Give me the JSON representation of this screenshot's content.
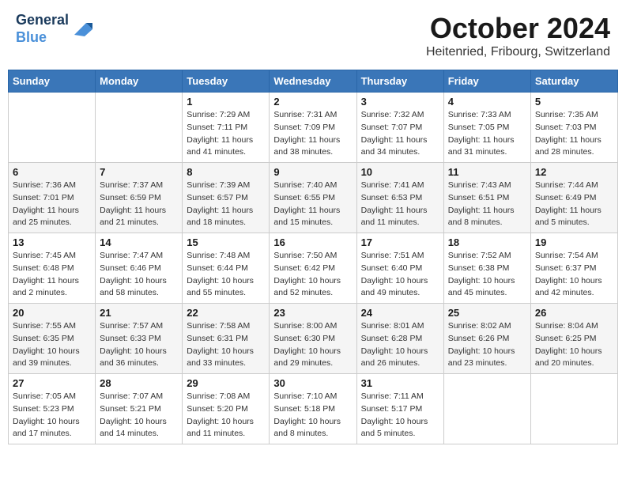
{
  "header": {
    "logo_line1": "General",
    "logo_line2": "Blue",
    "title": "October 2024",
    "subtitle": "Heitenried, Fribourg, Switzerland"
  },
  "calendar": {
    "days_of_week": [
      "Sunday",
      "Monday",
      "Tuesday",
      "Wednesday",
      "Thursday",
      "Friday",
      "Saturday"
    ],
    "weeks": [
      [
        {
          "day": "",
          "info": ""
        },
        {
          "day": "",
          "info": ""
        },
        {
          "day": "1",
          "info": "Sunrise: 7:29 AM\nSunset: 7:11 PM\nDaylight: 11 hours and 41 minutes."
        },
        {
          "day": "2",
          "info": "Sunrise: 7:31 AM\nSunset: 7:09 PM\nDaylight: 11 hours and 38 minutes."
        },
        {
          "day": "3",
          "info": "Sunrise: 7:32 AM\nSunset: 7:07 PM\nDaylight: 11 hours and 34 minutes."
        },
        {
          "day": "4",
          "info": "Sunrise: 7:33 AM\nSunset: 7:05 PM\nDaylight: 11 hours and 31 minutes."
        },
        {
          "day": "5",
          "info": "Sunrise: 7:35 AM\nSunset: 7:03 PM\nDaylight: 11 hours and 28 minutes."
        }
      ],
      [
        {
          "day": "6",
          "info": "Sunrise: 7:36 AM\nSunset: 7:01 PM\nDaylight: 11 hours and 25 minutes."
        },
        {
          "day": "7",
          "info": "Sunrise: 7:37 AM\nSunset: 6:59 PM\nDaylight: 11 hours and 21 minutes."
        },
        {
          "day": "8",
          "info": "Sunrise: 7:39 AM\nSunset: 6:57 PM\nDaylight: 11 hours and 18 minutes."
        },
        {
          "day": "9",
          "info": "Sunrise: 7:40 AM\nSunset: 6:55 PM\nDaylight: 11 hours and 15 minutes."
        },
        {
          "day": "10",
          "info": "Sunrise: 7:41 AM\nSunset: 6:53 PM\nDaylight: 11 hours and 11 minutes."
        },
        {
          "day": "11",
          "info": "Sunrise: 7:43 AM\nSunset: 6:51 PM\nDaylight: 11 hours and 8 minutes."
        },
        {
          "day": "12",
          "info": "Sunrise: 7:44 AM\nSunset: 6:49 PM\nDaylight: 11 hours and 5 minutes."
        }
      ],
      [
        {
          "day": "13",
          "info": "Sunrise: 7:45 AM\nSunset: 6:48 PM\nDaylight: 11 hours and 2 minutes."
        },
        {
          "day": "14",
          "info": "Sunrise: 7:47 AM\nSunset: 6:46 PM\nDaylight: 10 hours and 58 minutes."
        },
        {
          "day": "15",
          "info": "Sunrise: 7:48 AM\nSunset: 6:44 PM\nDaylight: 10 hours and 55 minutes."
        },
        {
          "day": "16",
          "info": "Sunrise: 7:50 AM\nSunset: 6:42 PM\nDaylight: 10 hours and 52 minutes."
        },
        {
          "day": "17",
          "info": "Sunrise: 7:51 AM\nSunset: 6:40 PM\nDaylight: 10 hours and 49 minutes."
        },
        {
          "day": "18",
          "info": "Sunrise: 7:52 AM\nSunset: 6:38 PM\nDaylight: 10 hours and 45 minutes."
        },
        {
          "day": "19",
          "info": "Sunrise: 7:54 AM\nSunset: 6:37 PM\nDaylight: 10 hours and 42 minutes."
        }
      ],
      [
        {
          "day": "20",
          "info": "Sunrise: 7:55 AM\nSunset: 6:35 PM\nDaylight: 10 hours and 39 minutes."
        },
        {
          "day": "21",
          "info": "Sunrise: 7:57 AM\nSunset: 6:33 PM\nDaylight: 10 hours and 36 minutes."
        },
        {
          "day": "22",
          "info": "Sunrise: 7:58 AM\nSunset: 6:31 PM\nDaylight: 10 hours and 33 minutes."
        },
        {
          "day": "23",
          "info": "Sunrise: 8:00 AM\nSunset: 6:30 PM\nDaylight: 10 hours and 29 minutes."
        },
        {
          "day": "24",
          "info": "Sunrise: 8:01 AM\nSunset: 6:28 PM\nDaylight: 10 hours and 26 minutes."
        },
        {
          "day": "25",
          "info": "Sunrise: 8:02 AM\nSunset: 6:26 PM\nDaylight: 10 hours and 23 minutes."
        },
        {
          "day": "26",
          "info": "Sunrise: 8:04 AM\nSunset: 6:25 PM\nDaylight: 10 hours and 20 minutes."
        }
      ],
      [
        {
          "day": "27",
          "info": "Sunrise: 7:05 AM\nSunset: 5:23 PM\nDaylight: 10 hours and 17 minutes."
        },
        {
          "day": "28",
          "info": "Sunrise: 7:07 AM\nSunset: 5:21 PM\nDaylight: 10 hours and 14 minutes."
        },
        {
          "day": "29",
          "info": "Sunrise: 7:08 AM\nSunset: 5:20 PM\nDaylight: 10 hours and 11 minutes."
        },
        {
          "day": "30",
          "info": "Sunrise: 7:10 AM\nSunset: 5:18 PM\nDaylight: 10 hours and 8 minutes."
        },
        {
          "day": "31",
          "info": "Sunrise: 7:11 AM\nSunset: 5:17 PM\nDaylight: 10 hours and 5 minutes."
        },
        {
          "day": "",
          "info": ""
        },
        {
          "day": "",
          "info": ""
        }
      ]
    ]
  }
}
